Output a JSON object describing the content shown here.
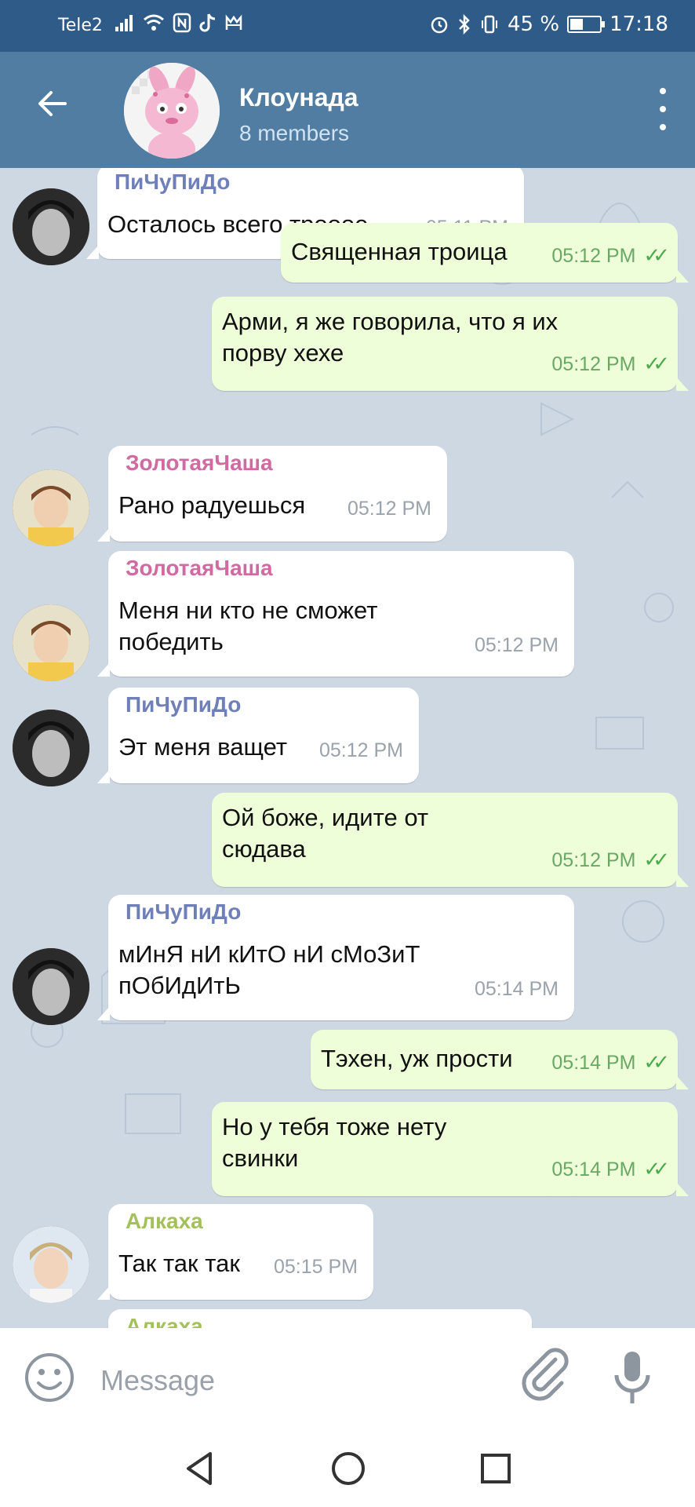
{
  "status_bar": {
    "carrier": "Tele2",
    "battery_percent": "45 %",
    "battery_level": 0.45,
    "time": "17:18",
    "icons": [
      "signal-icon",
      "wifi-icon",
      "nfc-icon",
      "tiktok-icon",
      "bluetooth-icon",
      "alarm-icon",
      "vibrate-icon",
      "battery-icon"
    ]
  },
  "header": {
    "title": "Клоунада",
    "subtitle": "8 members"
  },
  "colors": {
    "header": "#517da2",
    "status_bar": "#2f5b88",
    "outgoing_bubble": "#eefed9",
    "incoming_bubble": "#ffffff",
    "read_ticks": "#4cab4d",
    "name_pichupido": "#6f7fb8",
    "name_zolotaya": "#d06aa0",
    "name_alkaha": "#a3c05a"
  },
  "messages": [
    {
      "dir": "in",
      "sender": "ПиЧуПиДо",
      "lines": [
        "Осталось всего троооe"
      ],
      "time": "05:11 PM"
    },
    {
      "dir": "out",
      "lines": [
        "Священная троица"
      ],
      "time": "05:12 PM",
      "read": true
    },
    {
      "dir": "out",
      "lines": [
        "Арми, я же говорила, что я их",
        "порву хехе"
      ],
      "time": "05:12 PM",
      "read": true
    },
    {
      "dir": "in",
      "sender": "ЗолотаяЧаша",
      "lines": [
        "Рано радуешься"
      ],
      "time": "05:12 PM"
    },
    {
      "dir": "in",
      "sender": "ЗолотаяЧаша",
      "lines": [
        "Меня ни кто не сможет",
        "победить"
      ],
      "time": "05:12 PM"
    },
    {
      "dir": "in",
      "sender": "ПиЧуПиДо",
      "lines": [
        "Эт меня ващет"
      ],
      "time": "05:12 PM"
    },
    {
      "dir": "out",
      "lines": [
        "Ой боже, идите от",
        "сюдава"
      ],
      "time": "05:12 PM",
      "read": true
    },
    {
      "dir": "in",
      "sender": "ПиЧуПиДо",
      "lines": [
        "мИнЯ нИ кИтО нИ сМоЗиТ",
        "пОбИдИтЬ"
      ],
      "time": "05:14 PM"
    },
    {
      "dir": "out",
      "lines": [
        "Тэхен, уж прости"
      ],
      "time": "05:14 PM",
      "read": true
    },
    {
      "dir": "out",
      "lines": [
        "Но у тебя тоже нету",
        "свинки"
      ],
      "time": "05:14 PM",
      "read": true
    },
    {
      "dir": "in",
      "sender": "Алкаха",
      "lines": [
        "Так так так"
      ],
      "time": "05:15 PM"
    },
    {
      "dir": "in",
      "sender": "Алкаха",
      "lines": [],
      "time": ""
    }
  ],
  "composer": {
    "placeholder": "Message"
  }
}
